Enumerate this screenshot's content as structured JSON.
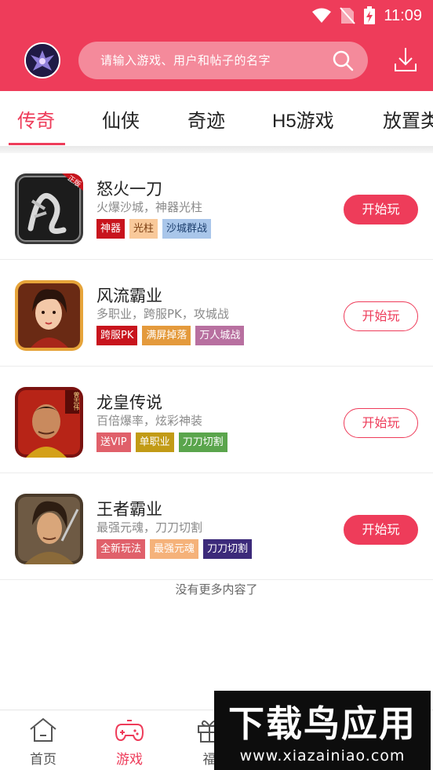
{
  "status_bar": {
    "time": "11:09"
  },
  "header": {
    "search_placeholder": "请输入游戏、用户和帖子的名字"
  },
  "tabs": [
    {
      "label": "传奇",
      "active": true
    },
    {
      "label": "仙侠",
      "active": false
    },
    {
      "label": "奇迹",
      "active": false
    },
    {
      "label": "H5游戏",
      "active": false
    },
    {
      "label": "放置类",
      "active": false
    }
  ],
  "games": [
    {
      "name": "怒火一刀",
      "desc": "火爆沙城，神器光柱",
      "tags": [
        {
          "text": "神器",
          "color": "#c8141d"
        },
        {
          "text": "光柱",
          "color": "#f9c99a"
        },
        {
          "text": "沙城群战",
          "color": "#a9c6ea"
        }
      ],
      "button": "开始玩",
      "button_style": "filled",
      "icon_badge": "正版"
    },
    {
      "name": "风流霸业",
      "desc": "多职业，跨服PK，攻城战",
      "tags": [
        {
          "text": "跨服PK",
          "color": "#c8141d"
        },
        {
          "text": "满屏掉落",
          "color": "#e49a3c"
        },
        {
          "text": "万人城战",
          "color": "#b870a0"
        }
      ],
      "button": "开始玩",
      "button_style": "outline"
    },
    {
      "name": "龙皇传说",
      "desc": "百倍爆率，炫彩神装",
      "tags": [
        {
          "text": "送VIP",
          "color": "#e0606a"
        },
        {
          "text": "单职业",
          "color": "#c29b16"
        },
        {
          "text": "刀刀切割",
          "color": "#5aa54c"
        }
      ],
      "button": "开始玩",
      "button_style": "outline",
      "icon_badge": "曾志伟"
    },
    {
      "name": "王者霸业",
      "desc": "最强元魂，刀刀切割",
      "tags": [
        {
          "text": "全新玩法",
          "color": "#e0606a"
        },
        {
          "text": "最强元魂",
          "color": "#f5b27a"
        },
        {
          "text": "刀刀切割",
          "color": "#3c2a7a"
        }
      ],
      "button": "开始玩",
      "button_style": "filled"
    }
  ],
  "no_more_text": "没有更多内容了",
  "bottom_nav": [
    {
      "label": "首页",
      "icon": "home-icon",
      "active": false
    },
    {
      "label": "游戏",
      "icon": "gamepad-icon",
      "active": true
    },
    {
      "label": "福",
      "icon": "gift-icon",
      "active": false
    }
  ],
  "watermark": {
    "logo_text": "下载鸟应用",
    "url": "www.xiazainiao.com"
  },
  "colors": {
    "accent": "#ee3c5a",
    "search_bg": "#f48a9b"
  }
}
